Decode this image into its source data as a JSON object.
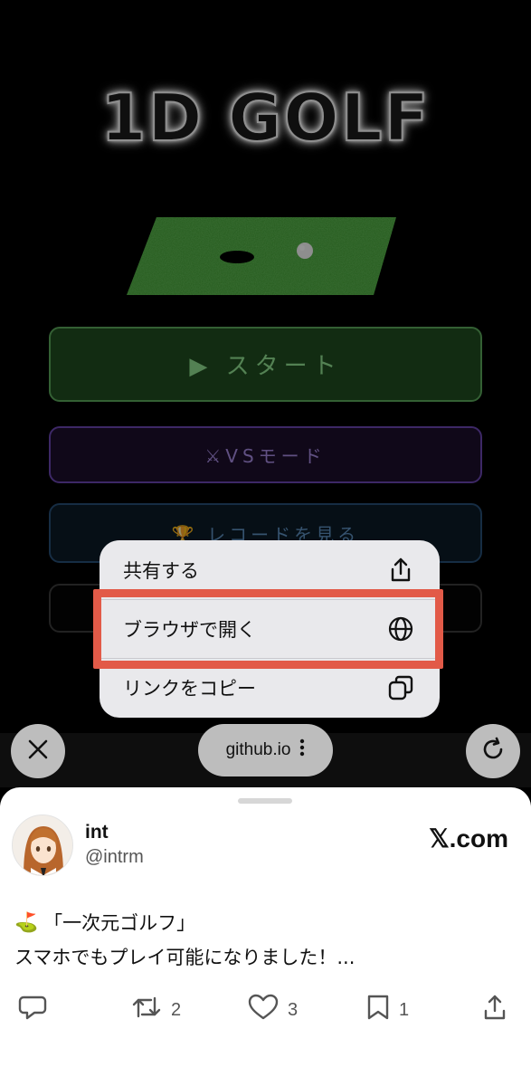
{
  "game": {
    "title": "1D GOLF",
    "buttons": {
      "start": "▶ スタート",
      "vs_mode": "⚔VSモード",
      "records": "🏆 レコードを見る"
    }
  },
  "context_menu": {
    "items": [
      {
        "label": "共有する",
        "icon": "share-icon"
      },
      {
        "label": "ブラウザで開く",
        "icon": "globe-icon"
      },
      {
        "label": "リンクをコピー",
        "icon": "copy-icon"
      }
    ],
    "highlighted_item": "ブラウザで開く",
    "highlight_color": "#e25a48"
  },
  "browser": {
    "url": "github.io"
  },
  "post": {
    "user_name": "int",
    "user_handle": "@intrm",
    "site": "𝕏.com",
    "line1_emoji": "⛳",
    "line1": "「一次元ゴルフ」",
    "line2": "スマホでもプレイ可能になりました！...",
    "actions": {
      "reposts": "2",
      "likes": "3",
      "bookmarks": "1"
    }
  }
}
